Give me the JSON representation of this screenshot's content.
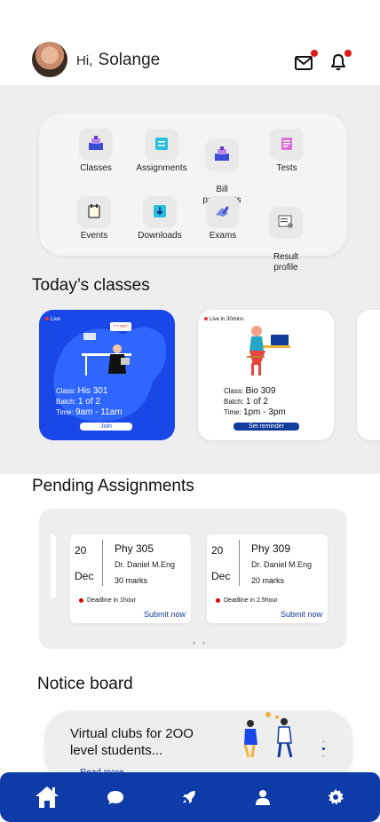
{
  "header": {
    "greeting": "Hi,",
    "user_name": "Solange",
    "mail_badge": "1",
    "bell_badge": "1"
  },
  "menu": [
    {
      "label": "Classes",
      "icon": "classes-icon"
    },
    {
      "label": "Assignments",
      "icon": "assignments-icon"
    },
    {
      "label": "Bill\npayments",
      "icon": "bill-payments-icon"
    },
    {
      "label": "Tests",
      "icon": "tests-icon"
    },
    {
      "label": "Events",
      "icon": "events-icon"
    },
    {
      "label": "Downloads",
      "icon": "downloads-icon"
    },
    {
      "label": "Exams",
      "icon": "exams-icon"
    },
    {
      "label": "Result\nprofile",
      "icon": "result-profile-icon"
    }
  ],
  "today_classes": {
    "title": "Today’s classes",
    "cards": [
      {
        "status": "Live",
        "class_label": "Class:",
        "class": "His 301",
        "batch_label": "Batch:",
        "batch": "1 of 2",
        "time_label": "Time:",
        "time": "9am - 11am",
        "button": "Join",
        "formula": "f = mc²"
      },
      {
        "status": "Live in 30mins",
        "class_label": "Class:",
        "class": "Bio 309",
        "batch_label": "Batch:",
        "batch": "1 of 2",
        "time_label": "Time:",
        "time": "1pm - 3pm",
        "button": "Set reminder"
      }
    ]
  },
  "pending_assignments": {
    "title": "Pending Assignments",
    "cards": [
      {
        "day": "20",
        "month": "Dec",
        "subject": "Phy 305",
        "lecturer": "Dr. Daniel M.Eng",
        "marks": "30 marks",
        "deadline": "Deadline in 1hour",
        "action": "Submit now"
      },
      {
        "day": "20",
        "month": "Dec",
        "subject": "Phy 309",
        "lecturer": "Dr. Daniel M.Eng",
        "marks": "20 marks",
        "deadline": "Deadline in 2.5hour",
        "action": "Submit now"
      }
    ]
  },
  "notice_board": {
    "title": "Notice board",
    "headline": "Virtual clubs for 2OO level students...",
    "link": "Read more"
  },
  "colors": {
    "brand_blue": "#0d3ba8",
    "live_card_blue": "#1a47e8",
    "band_gray": "#eeeeee",
    "badge_red": "#d91b1b"
  },
  "bottom_nav": [
    "home-icon",
    "chat-icon",
    "rocket-icon",
    "profile-icon",
    "settings-icon"
  ]
}
